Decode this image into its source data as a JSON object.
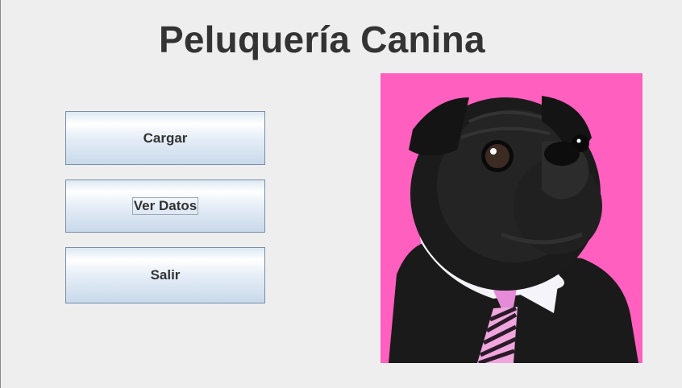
{
  "window": {
    "title": "Peluquería Canina"
  },
  "buttons": {
    "cargar": "Cargar",
    "ver_datos": "Ver Datos",
    "salir": "Salir"
  },
  "colors": {
    "background": "#eeeeee",
    "photo_background": "#ff5fbf",
    "title_text": "#333333"
  },
  "image": {
    "icon": "pug-dog-photo"
  }
}
